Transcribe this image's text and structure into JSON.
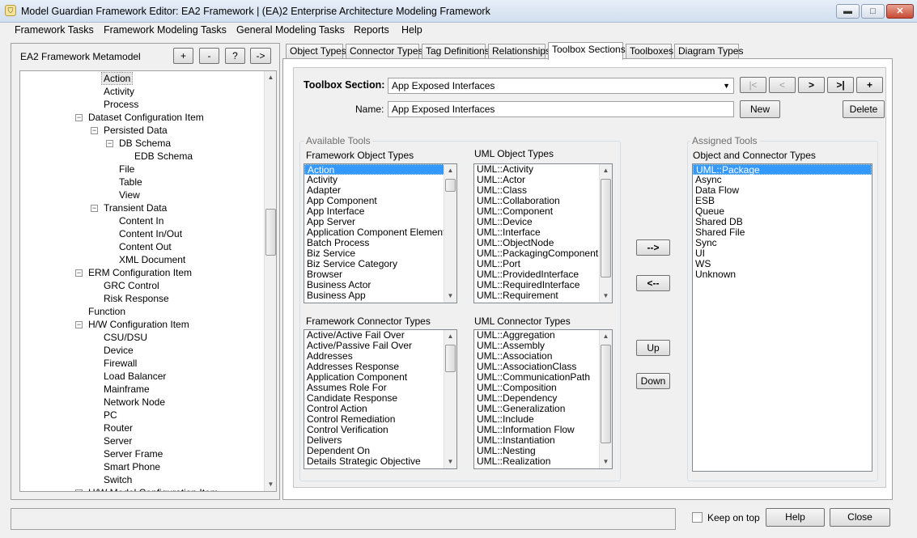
{
  "window": {
    "title": "Model Guardian Framework Editor: EA2 Framework | (EA)2 Enterprise Architecture Modeling Framework",
    "app_icon": "shield-icon",
    "controls": {
      "minimize": "▬",
      "maximize": "□",
      "close": "✕"
    }
  },
  "menu": [
    "Framework Tasks",
    "Framework Modeling Tasks",
    "General Modeling Tasks",
    "Reports",
    "Help"
  ],
  "left_panel": {
    "title": "EA2 Framework Metamodel",
    "buttons": [
      "+",
      "-",
      "?",
      "->"
    ],
    "tree": [
      {
        "label": "Action",
        "level": 5,
        "selected": true
      },
      {
        "label": "Activity",
        "level": 5
      },
      {
        "label": "Process",
        "level": 5
      },
      {
        "label": "Dataset Configuration Item",
        "level": 4,
        "expander": "−"
      },
      {
        "label": "Persisted Data",
        "level": 5,
        "expander": "−"
      },
      {
        "label": "DB Schema",
        "level": 6,
        "expander": "−"
      },
      {
        "label": "EDB Schema",
        "level": 7
      },
      {
        "label": "File",
        "level": 6
      },
      {
        "label": "Table",
        "level": 6
      },
      {
        "label": "View",
        "level": 6
      },
      {
        "label": "Transient Data",
        "level": 5,
        "expander": "−"
      },
      {
        "label": "Content In",
        "level": 6
      },
      {
        "label": "Content In/Out",
        "level": 6
      },
      {
        "label": "Content Out",
        "level": 6
      },
      {
        "label": "XML Document",
        "level": 6
      },
      {
        "label": "ERM Configuration Item",
        "level": 4,
        "expander": "−"
      },
      {
        "label": "GRC Control",
        "level": 5
      },
      {
        "label": "Risk Response",
        "level": 5
      },
      {
        "label": "Function",
        "level": 4
      },
      {
        "label": "H/W Configuration Item",
        "level": 4,
        "expander": "−"
      },
      {
        "label": "CSU/DSU",
        "level": 5
      },
      {
        "label": "Device",
        "level": 5
      },
      {
        "label": "Firewall",
        "level": 5
      },
      {
        "label": "Load Balancer",
        "level": 5
      },
      {
        "label": "Mainframe",
        "level": 5
      },
      {
        "label": "Network Node",
        "level": 5
      },
      {
        "label": "PC",
        "level": 5
      },
      {
        "label": "Router",
        "level": 5
      },
      {
        "label": "Server",
        "level": 5
      },
      {
        "label": "Server Frame",
        "level": 5
      },
      {
        "label": "Smart Phone",
        "level": 5
      },
      {
        "label": "Switch",
        "level": 5
      },
      {
        "label": "H/W Model Configuration Item",
        "level": 4,
        "expander": "−"
      }
    ]
  },
  "tabs": [
    {
      "label": "Object Types"
    },
    {
      "label": "Connector Types"
    },
    {
      "label": "Tag Definitions"
    },
    {
      "label": "Relationships"
    },
    {
      "label": "Toolbox Sections",
      "active": true
    },
    {
      "label": "Toolboxes"
    },
    {
      "label": "Diagram Types"
    }
  ],
  "toolbox": {
    "section_label": "Toolbox Section:",
    "section_value": "App Exposed Interfaces",
    "nav_buttons": [
      "|<",
      "<",
      ">",
      ">|",
      "+"
    ],
    "name_label": "Name:",
    "name_value": "App Exposed Interfaces",
    "new_label": "New",
    "delete_label": "Delete"
  },
  "available": {
    "group_title": "Available Tools",
    "framework_object_label": "Framework Object Types",
    "framework_object_types": [
      "Action",
      "Activity",
      "Adapter",
      "App Component",
      "App Interface",
      "App Server",
      "Application Component Element",
      "Batch Process",
      "Biz Service",
      "Biz Service Category",
      "Browser",
      "Business Actor",
      "Business App"
    ],
    "uml_object_label": "UML Object Types",
    "uml_object_types": [
      "UML::Activity",
      "UML::Actor",
      "UML::Class",
      "UML::Collaboration",
      "UML::Component",
      "UML::Device",
      "UML::Interface",
      "UML::ObjectNode",
      "UML::PackagingComponent",
      "UML::Port",
      "UML::ProvidedInterface",
      "UML::RequiredInterface",
      "UML::Requirement"
    ],
    "framework_connector_label": "Framework Connector Types",
    "framework_connector_types": [
      "Active/Active Fail Over",
      "Active/Passive Fail Over",
      "Addresses",
      "Addresses Response",
      "Application Component",
      "Assumes Role For",
      "Candidate Response",
      "Control Action",
      "Control Remediation",
      "Control Verification",
      "Delivers",
      "Dependent On",
      "Details Strategic Objective"
    ],
    "uml_connector_label": "UML Connector Types",
    "uml_connector_types": [
      "UML::Aggregation",
      "UML::Assembly",
      "UML::Association",
      "UML::AssociationClass",
      "UML::CommunicationPath",
      "UML::Composition",
      "UML::Dependency",
      "UML::Generalization",
      "UML::Include",
      "UML::Information Flow",
      "UML::Instantiation",
      "UML::Nesting",
      "UML::Realization"
    ]
  },
  "transfer": {
    "add": "-->",
    "remove": "<--",
    "up": "Up",
    "down": "Down"
  },
  "assigned": {
    "group_title": "Assigned Tools",
    "list_label": "Object and Connector Types",
    "items": [
      "UML::Package",
      "Async",
      "Data Flow",
      "ESB",
      "Queue",
      "Shared DB",
      "Shared File",
      "Sync",
      "UI",
      "WS",
      "Unknown"
    ]
  },
  "footer": {
    "keep_on_top": "Keep on top",
    "help": "Help",
    "close": "Close"
  }
}
